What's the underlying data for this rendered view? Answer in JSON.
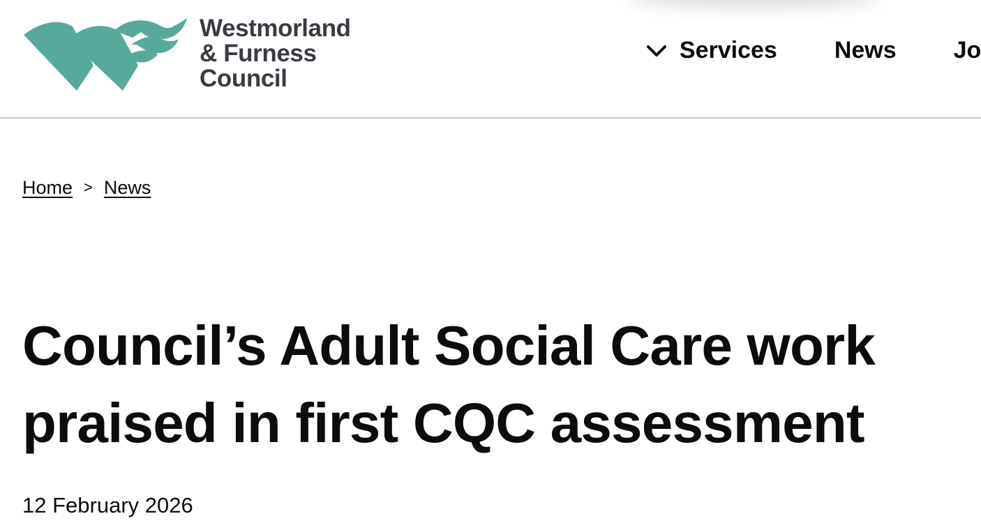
{
  "brand": {
    "name_lines": [
      "Westmorland",
      "& Furness",
      "Council"
    ],
    "logo_icon": "westmorland-furness-wf-mark",
    "accent_color": "#57a99b",
    "text_color": "#3a3b44"
  },
  "nav": {
    "items": [
      {
        "label": "Services",
        "icon": "chevron-down-icon"
      },
      {
        "label": "News"
      },
      {
        "label": "Jobs"
      }
    ]
  },
  "breadcrumb": {
    "home": "Home",
    "separator": ">",
    "news": "News"
  },
  "article": {
    "title": "Council’s Adult Social Care work praised in first CQC assessment",
    "date": "12 February 2026"
  }
}
